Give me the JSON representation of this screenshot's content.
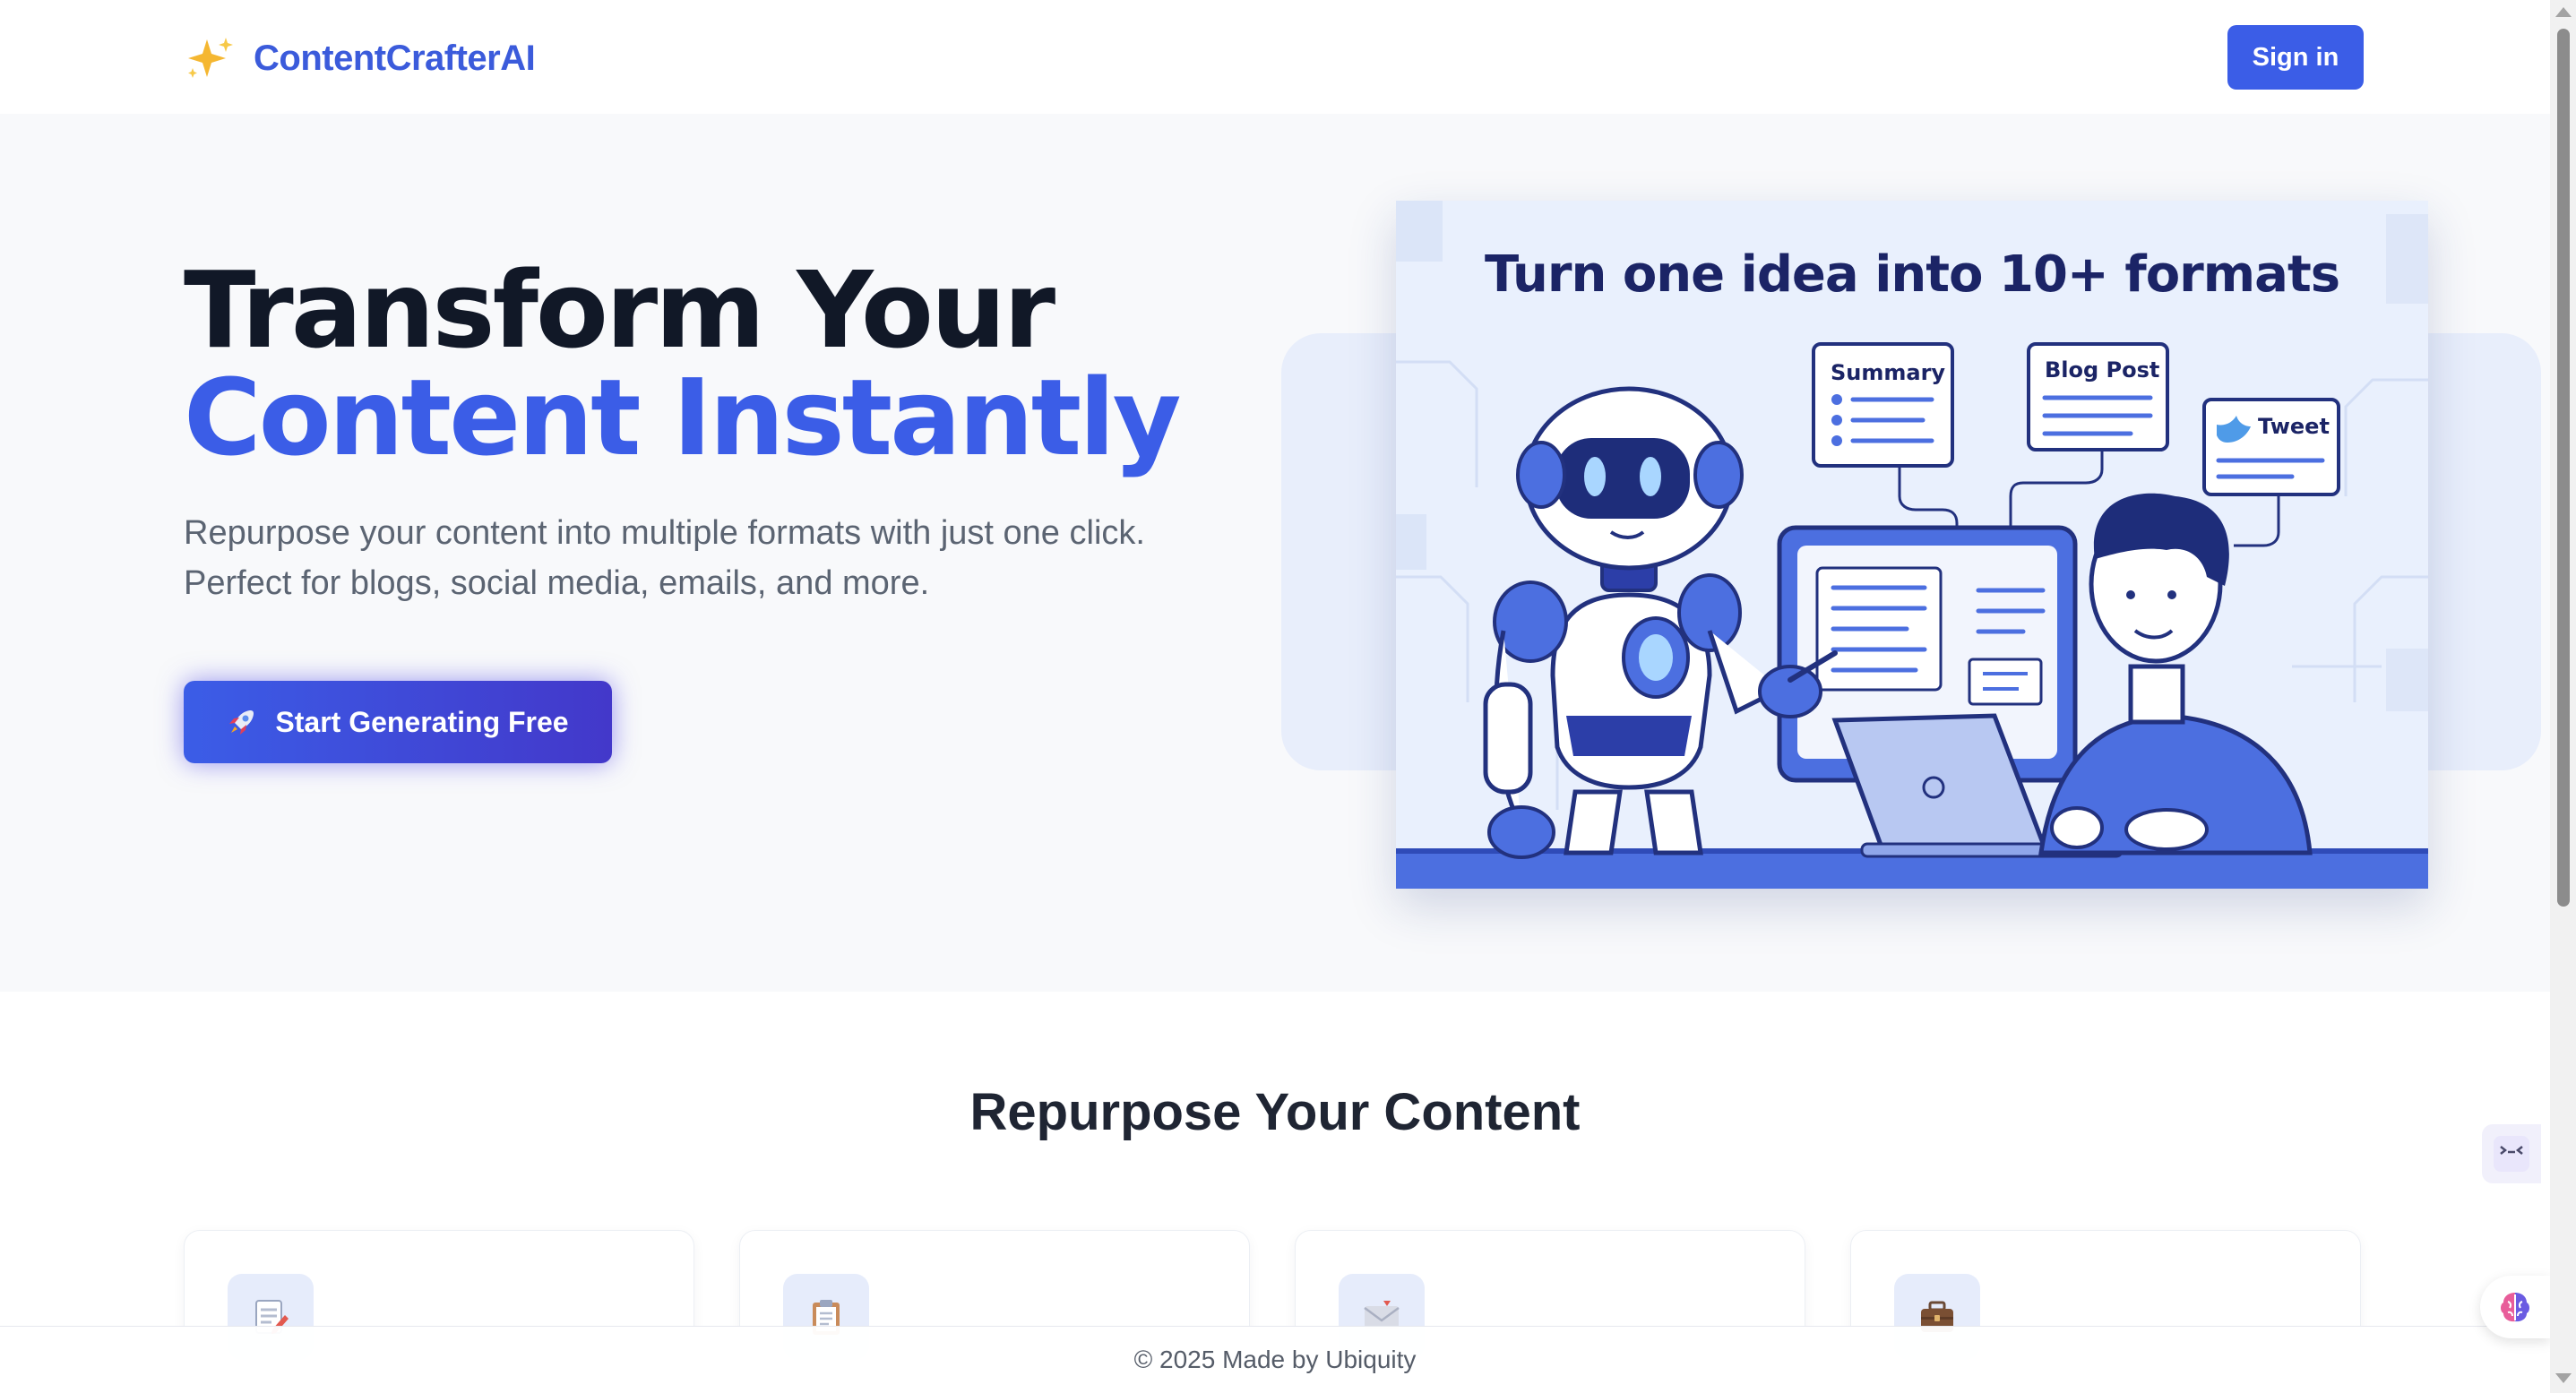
{
  "header": {
    "brand_name": "ContentCrafterAI",
    "brand_icon": "sparkles-icon",
    "signin_label": "Sign in"
  },
  "hero": {
    "title_line1": "Transform Your",
    "title_line2": "Content Instantly",
    "subtitle_line1": "Repurpose your content into multiple formats with just one click.",
    "subtitle_line2": "Perfect for blogs, social media, emails, and more.",
    "cta_label": "Start Generating Free",
    "cta_icon": "rocket-icon"
  },
  "illustration": {
    "title": "Turn one idea into 10+ formats",
    "cards": [
      "Summary",
      "Blog Post",
      "Tweet"
    ]
  },
  "features": {
    "section_title": "Repurpose Your Content",
    "cards": [
      {
        "icon": "memo-icon"
      },
      {
        "icon": "clipboard-icon"
      },
      {
        "icon": "envelope-icon"
      },
      {
        "icon": "briefcase-icon"
      }
    ]
  },
  "footer": {
    "text": "© 2025 Made by Ubiquity"
  },
  "colors": {
    "accent": "#3b5de7",
    "brand": "#3b5bdb",
    "heading_dark": "#111827",
    "hero_background": "#f8f9fb"
  }
}
